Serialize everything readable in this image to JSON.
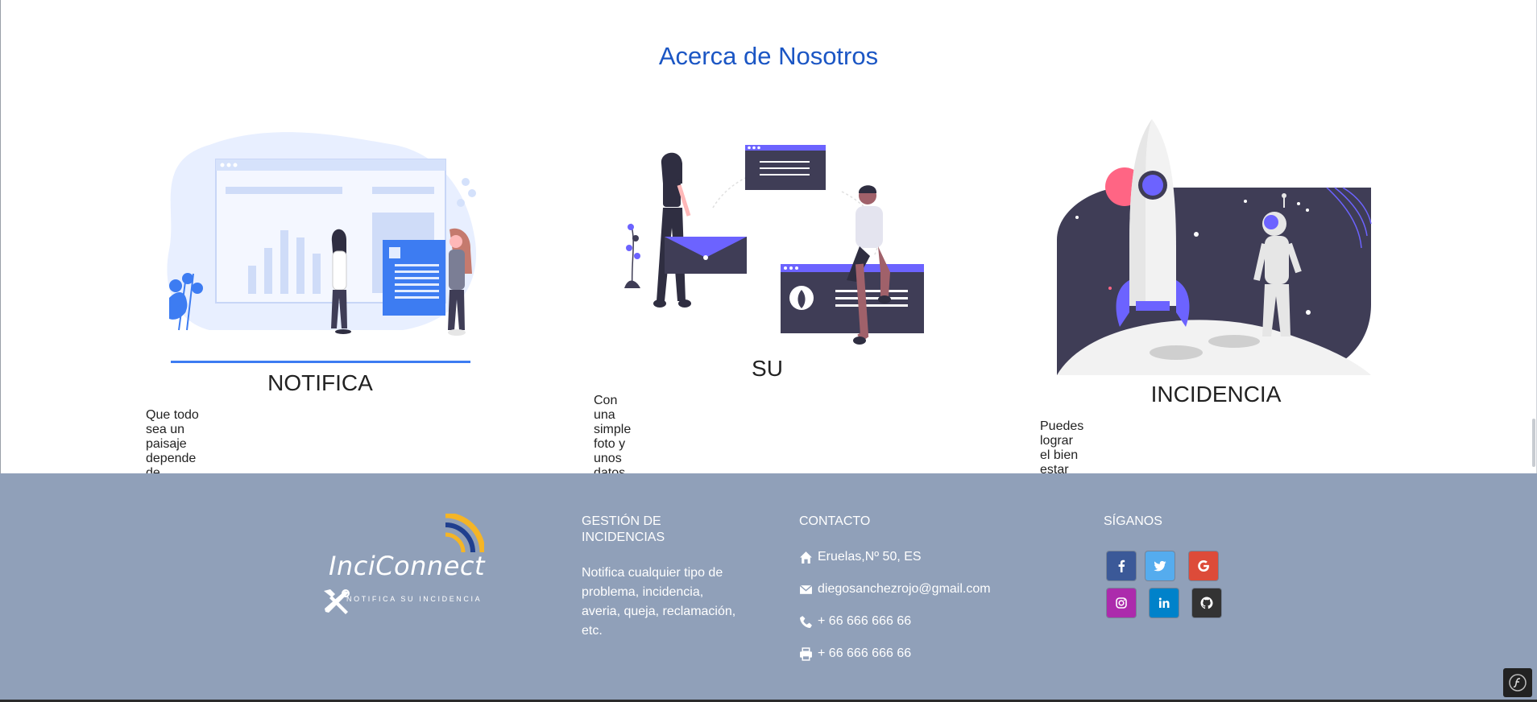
{
  "about": {
    "title": "Acerca de Nosotros"
  },
  "features": [
    {
      "title": "NOTIFICA",
      "text": "Que todo sea un paisaje depende de nosotros.",
      "illustration": "dashboard-illustration"
    },
    {
      "title": "SU",
      "text": "Con una simple foto y unos datos.",
      "illustration": "people-messaging-illustration"
    },
    {
      "title": "INCIDENCIA",
      "text": "Puedes lograr el bien estar de todos.",
      "illustration": "rocket-astronaut-illustration"
    }
  ],
  "footer": {
    "logo": {
      "name": "InciConnect",
      "tagline": "NOTIFICA SU INCIDENCIA"
    },
    "gestion": {
      "heading": "GESTIÓN DE INCIDENCIAS",
      "text": "Notifica cualquier tipo de problema, incidencia, averia, queja, reclamación, etc."
    },
    "contacto": {
      "heading": "CONTACTO",
      "address": "Eruelas,Nº 50, ES",
      "email": "diegosanchezrojo@gmail.com",
      "phone": "+ 66 666 666 66",
      "fax": "+ 66 666 666 66"
    },
    "siganos": {
      "heading": "SÍGANOS",
      "networks": [
        {
          "name": "facebook",
          "icon": "facebook-icon",
          "color": "#3b5998"
        },
        {
          "name": "twitter",
          "icon": "twitter-icon",
          "color": "#55acee"
        },
        {
          "name": "google",
          "icon": "google-icon",
          "color": "#dd4b39"
        },
        {
          "name": "instagram",
          "icon": "instagram-icon",
          "color": "#ac2bac"
        },
        {
          "name": "linkedin",
          "icon": "linkedin-icon",
          "color": "#0082ca"
        },
        {
          "name": "github",
          "icon": "github-icon",
          "color": "#333333"
        }
      ]
    },
    "colors": {
      "background": "#90a0b9",
      "accent": "#1b56c4"
    }
  },
  "debug_toolbar": {
    "icon": "symfony-icon"
  }
}
